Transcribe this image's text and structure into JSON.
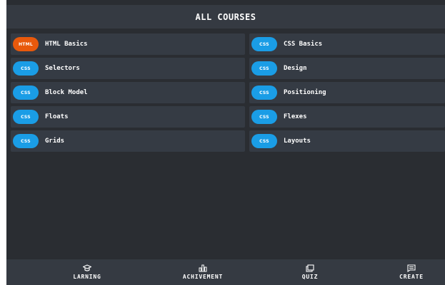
{
  "header": {
    "title": "ALL COURSES"
  },
  "colors": {
    "html_badge": "#e8590c",
    "css_badge": "#1a9de6"
  },
  "courses": [
    {
      "badge": "HTML",
      "title": "HTML Basics",
      "color": "#e8590c"
    },
    {
      "badge": "CSS",
      "title": "CSS Basics",
      "color": "#1a9de6"
    },
    {
      "badge": "CSS",
      "title": "Selectors",
      "color": "#1a9de6"
    },
    {
      "badge": "CSS",
      "title": "Design",
      "color": "#1a9de6"
    },
    {
      "badge": "CSS",
      "title": "Block Model",
      "color": "#1a9de6"
    },
    {
      "badge": "CSS",
      "title": "Positioning",
      "color": "#1a9de6"
    },
    {
      "badge": "CSS",
      "title": "Floats",
      "color": "#1a9de6"
    },
    {
      "badge": "CSS",
      "title": "Flexes",
      "color": "#1a9de6"
    },
    {
      "badge": "CSS",
      "title": "Grids",
      "color": "#1a9de6"
    },
    {
      "badge": "CSS",
      "title": "Layouts",
      "color": "#1a9de6"
    }
  ],
  "tabs": [
    {
      "label": "LARNING",
      "icon": "graduation-cap-icon"
    },
    {
      "label": "ACHIVEMENT",
      "icon": "bar-chart-icon"
    },
    {
      "label": "QUIZ",
      "icon": "quiz-icon"
    },
    {
      "label": "CREATE",
      "icon": "note-icon"
    }
  ]
}
